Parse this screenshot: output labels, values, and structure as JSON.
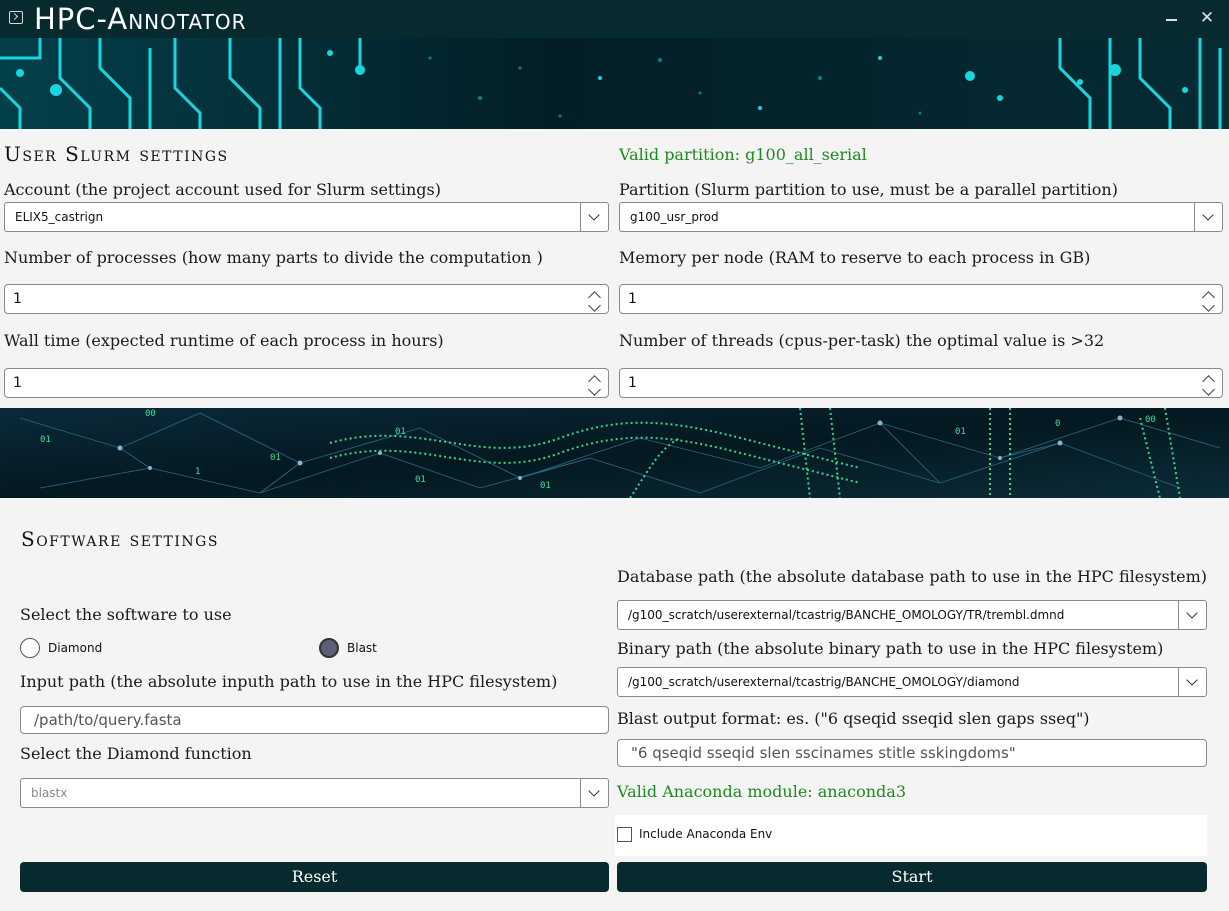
{
  "window": {
    "title": "HPC-Annotator",
    "minimize_icon": "minimize-icon",
    "close_glyph": "✕"
  },
  "slurm": {
    "section_title": "User Slurm settings",
    "partition_status": "Valid partition: g100_all_serial",
    "account_label": "Account (the project account used for Slurm settings)",
    "account_value": "ELIX5_castrign",
    "partition_label": "Partition (Slurm partition to use, must be a parallel partition)",
    "partition_value": "g100_usr_prod",
    "processes_label": "Number of processes (how many parts to divide the computation )",
    "processes_value": "1",
    "memory_label": "Memory per node (RAM to reserve to each process in GB)",
    "memory_value": "1",
    "walltime_label": "Wall time (expected runtime of each process in hours)",
    "walltime_value": "1",
    "threads_label": "Number of threads (cpus-per-task) the optimal value is >32",
    "threads_value": "1"
  },
  "software": {
    "section_title": "Software settings",
    "select_label": "Select the software to use",
    "options": [
      {
        "label": "Diamond",
        "checked": false
      },
      {
        "label": "Blast",
        "checked": true
      }
    ],
    "input_label": "Input path (the absolute inputh path to use in the HPC filesystem)",
    "input_placeholder": "/path/to/query.fasta",
    "function_label": "Select the Diamond function",
    "function_value": "blastx",
    "database_label": "Database path (the absolute database path to use in the HPC filesystem)",
    "database_value": "/g100_scratch/userexternal/tcastrig/BANCHE_OMOLOGY/TR/trembl.dmnd",
    "binary_label": "Binary path (the absolute binary path to use in the HPC filesystem)",
    "binary_value": "/g100_scratch/userexternal/tcastrig/BANCHE_OMOLOGY/diamond",
    "outfmt_label": "Blast output format: es. (\"6 qseqid sseqid slen gaps sseq\")",
    "outfmt_placeholder": "\"6 qseqid sseqid slen sscinames stitle sskingdoms\"",
    "anaconda_status": "Valid Anaconda module: anaconda3",
    "include_env_label": "Include Anaconda Env",
    "include_env_checked": false
  },
  "buttons": {
    "reset": "Reset",
    "start": "Start"
  },
  "colors": {
    "accent": "#062a2e",
    "valid": "#1e8a1e",
    "circuit": "#18d6e0",
    "network": "#3fe09a"
  }
}
